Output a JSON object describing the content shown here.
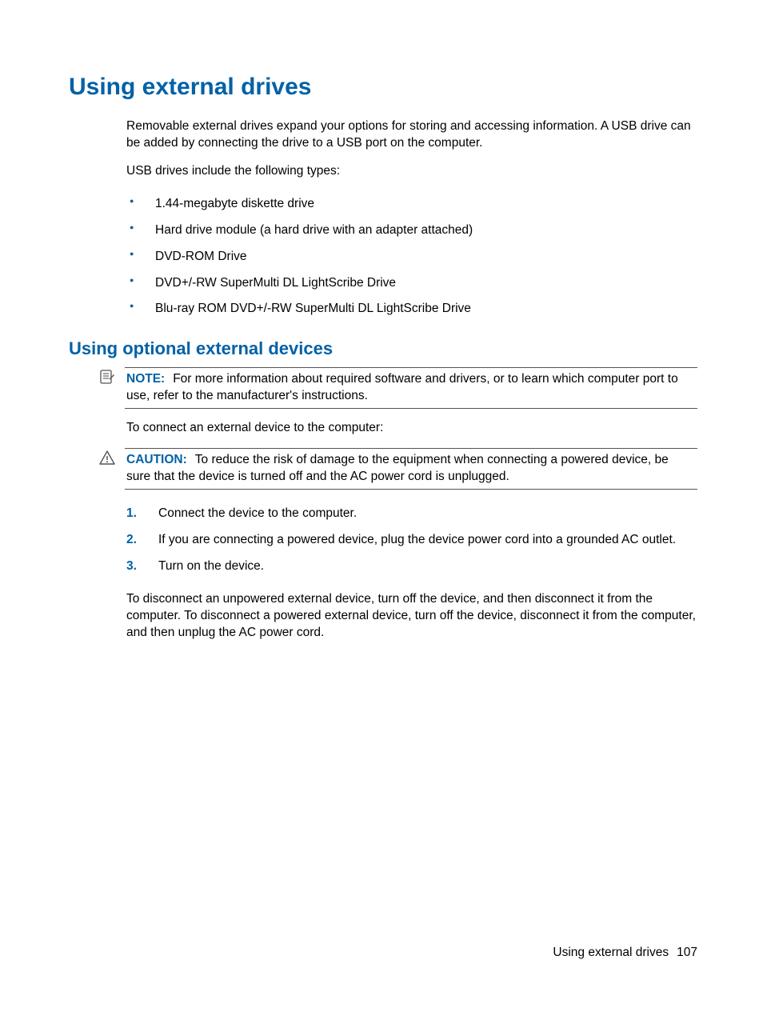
{
  "heading1": "Using external drives",
  "intro_p1": "Removable external drives expand your options for storing and accessing information. A USB drive can be added by connecting the drive to a USB port on the computer.",
  "intro_p2": "USB drives include the following types:",
  "bullets": [
    "1.44-megabyte diskette drive",
    "Hard drive module (a hard drive with an adapter attached)",
    "DVD-ROM Drive",
    "DVD+/-RW SuperMulti DL LightScribe Drive",
    "Blu-ray ROM DVD+/-RW SuperMulti DL LightScribe Drive"
  ],
  "heading2": "Using optional external devices",
  "note": {
    "label": "NOTE:",
    "text": "For more information about required software and drivers, or to learn which computer port to use, refer to the manufacturer's instructions."
  },
  "connect_intro": "To connect an external device to the computer:",
  "caution": {
    "label": "CAUTION:",
    "text": "To reduce the risk of damage to the equipment when connecting a powered device, be sure that the device is turned off and the AC power cord is unplugged."
  },
  "steps": [
    "Connect the device to the computer.",
    "If you are connecting a powered device, plug the device power cord into a grounded AC outlet.",
    "Turn on the device."
  ],
  "disconnect_p": "To disconnect an unpowered external device, turn off the device, and then disconnect it from the computer. To disconnect a powered external device, turn off the device, disconnect it from the computer, and then unplug the AC power cord.",
  "footer": {
    "text": "Using external drives",
    "page": "107"
  }
}
